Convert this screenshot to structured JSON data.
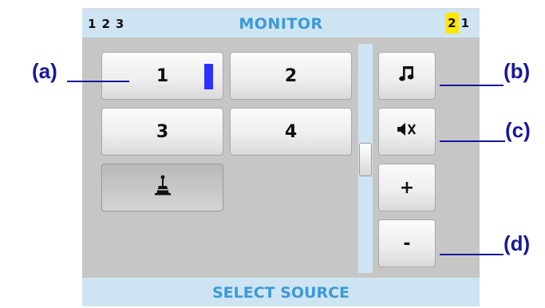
{
  "header": {
    "bank_numbers": [
      "1",
      "2",
      "3"
    ],
    "title": "MONITOR",
    "channel_active": "2",
    "channel_other": "1"
  },
  "sources": [
    {
      "label": "1",
      "selected": true
    },
    {
      "label": "2",
      "selected": false
    },
    {
      "label": "3",
      "selected": false
    },
    {
      "label": "4",
      "selected": false
    }
  ],
  "side_buttons": {
    "music_icon": "music-note-icon",
    "mute_icon": "speaker-mute-icon",
    "volume_up": "+",
    "volume_down": "-"
  },
  "footer": {
    "label": "SELECT SOURCE"
  },
  "callouts": {
    "a": "(a)",
    "b": "(b)",
    "c": "(c)",
    "d": "(d)"
  },
  "colors": {
    "accent": "#3a9ad6",
    "active_channel": "#ffe800",
    "source_indicator": "#2f2fff",
    "callout": "#18189a"
  }
}
